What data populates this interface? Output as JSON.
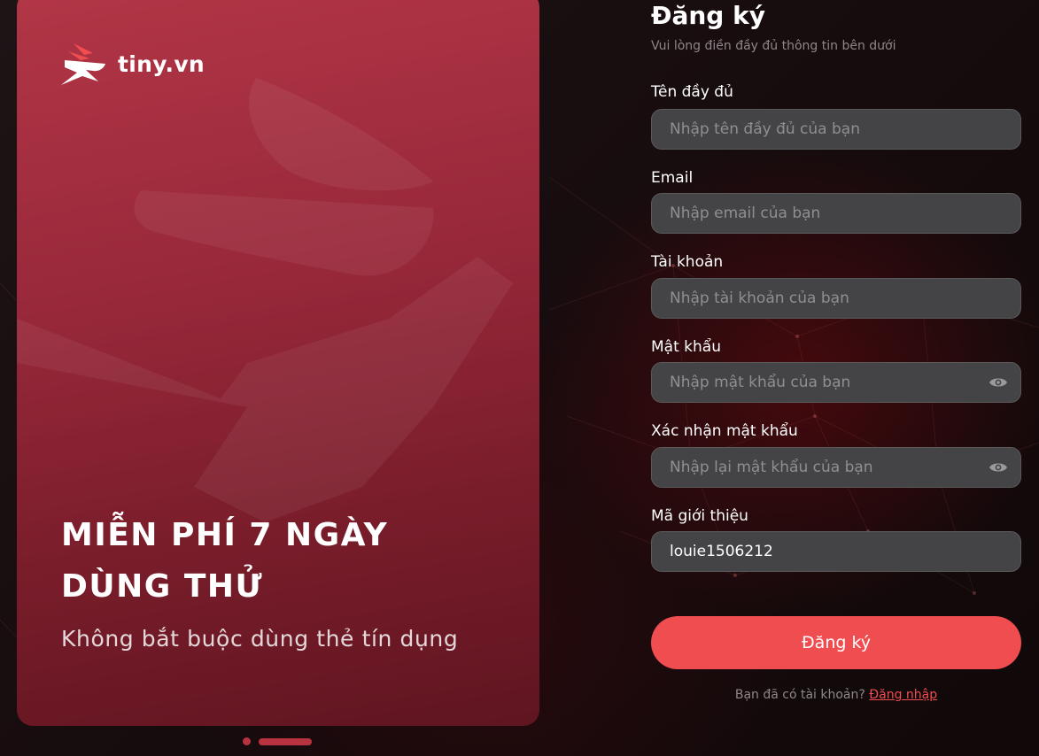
{
  "brand": {
    "name": "tiny.vn"
  },
  "promo": {
    "title_line1": "MIỄN PHÍ 7 NGÀY",
    "title_line2": "DÙNG THỬ",
    "subtitle": "Không bắt buộc dùng thẻ tín dụng"
  },
  "form": {
    "title": "Đăng ký",
    "subtitle": "Vui lòng điền đầy đủ thông tin bên dưới",
    "fields": [
      {
        "label": "Tên đầy đủ",
        "placeholder": "Nhập tên đầy đủ của bạn",
        "value": ""
      },
      {
        "label": "Email",
        "placeholder": "Nhập email của bạn",
        "value": ""
      },
      {
        "label": "Tài khoản",
        "placeholder": "Nhập tài khoản của bạn",
        "value": ""
      },
      {
        "label": "Mật khẩu",
        "placeholder": "Nhập mật khẩu của bạn",
        "value": ""
      },
      {
        "label": "Xác nhận mật khẩu",
        "placeholder": "Nhập lại mật khẩu của bạn",
        "value": ""
      },
      {
        "label": "Mã giới thiệu",
        "placeholder": "",
        "value": "louie1506212"
      }
    ],
    "submit_label": "Đăng ký",
    "footer_text": "Bạn đã có tài khoản?",
    "footer_link": "Đăng nhập"
  },
  "icons": {
    "logo": "rabbit-logo-icon",
    "password_toggle": "eye-icon"
  },
  "colors": {
    "accent": "#ef4d4f",
    "card": "#a02d3e",
    "input_bg": "#444446"
  }
}
